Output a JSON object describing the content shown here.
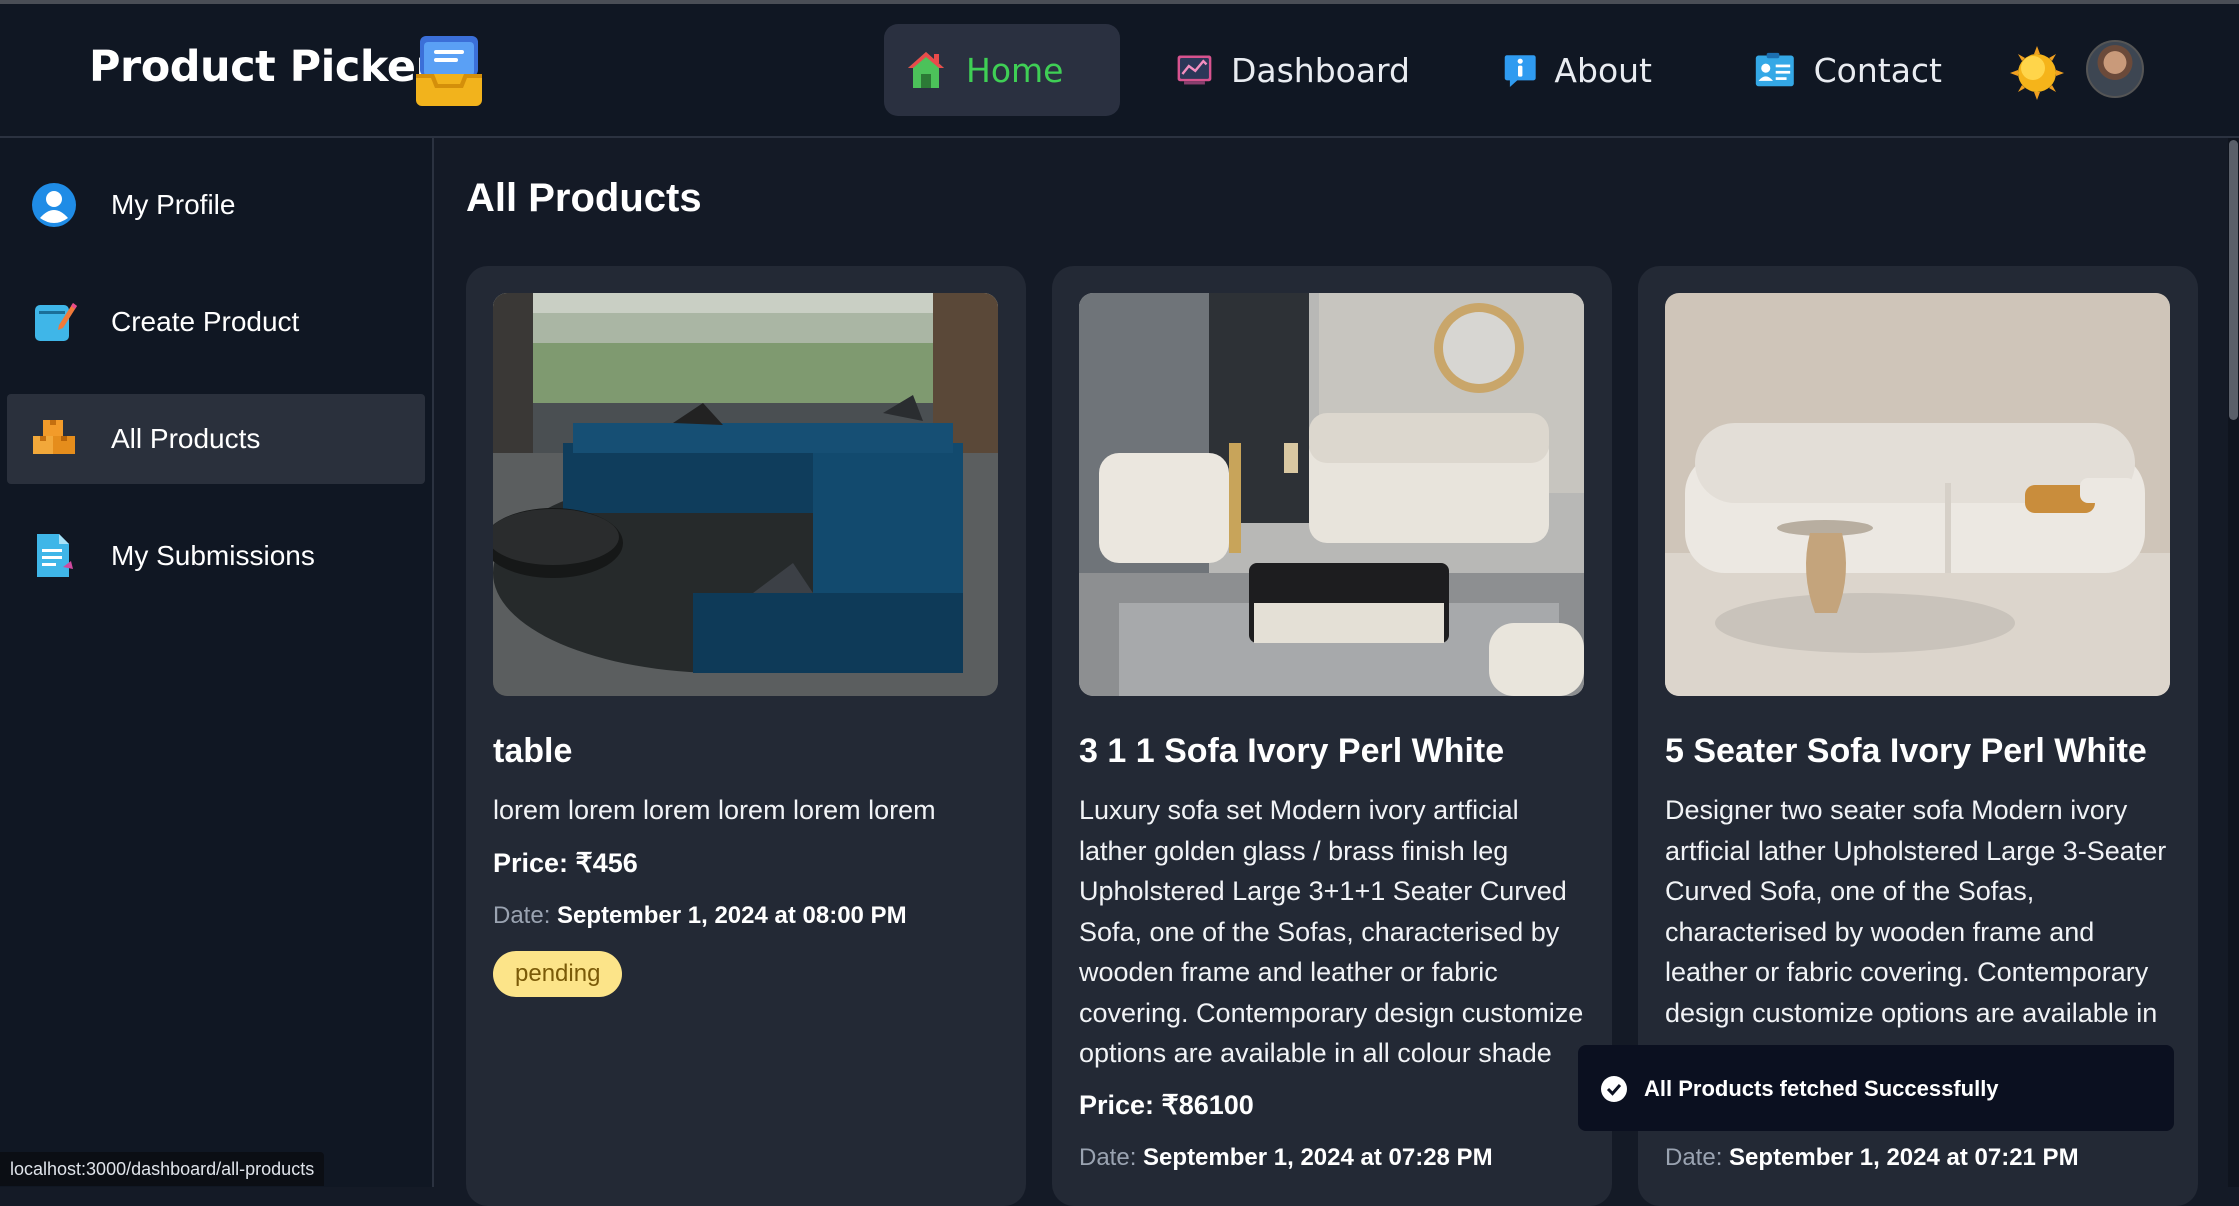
{
  "header": {
    "brand": "Product Picker",
    "nav": [
      {
        "label": "Home",
        "active": true
      },
      {
        "label": "Dashboard"
      },
      {
        "label": "About"
      },
      {
        "label": "Contact"
      }
    ]
  },
  "sidebar": {
    "items": [
      {
        "label": "My Profile"
      },
      {
        "label": "Create Product"
      },
      {
        "label": "All Products",
        "active": true
      },
      {
        "label": "My Submissions"
      }
    ]
  },
  "main": {
    "title": "All Products",
    "date_label": "Date:",
    "products": [
      {
        "title": "table",
        "description": "lorem lorem lorem lorem lorem lorem",
        "price": "Price: ₹456",
        "date": "September 1, 2024 at 08:00 PM",
        "status": "pending"
      },
      {
        "title": "3 1 1 Sofa Ivory Perl White",
        "description": "Luxury sofa set Modern ivory artficial lather golden glass / brass finish leg Upholstered Large 3+1+1 Seater Curved Sofa, one of the Sofas, characterised by wooden frame and leather or fabric covering. Contemporary design customize options are available in all colour shade",
        "price": "Price: ₹86100",
        "date": "September 1, 2024 at 07:28 PM"
      },
      {
        "title": "5 Seater Sofa Ivory Perl White",
        "description": "Designer two seater sofa Modern ivory artficial lather Upholstered Large 3-Seater Curved Sofa, one of the Sofas, characterised by wooden frame and leather or fabric covering. Contemporary design customize options are available in",
        "date": "September 1, 2024 at 07:21 PM"
      }
    ]
  },
  "toast": {
    "message": "All Products fetched Successfully"
  },
  "statusbar": {
    "url": "localhost:3000/dashboard/all-products"
  },
  "colors": {
    "accent_green": "#3fcf55",
    "badge_bg": "#fce489",
    "card_bg": "#232935"
  }
}
